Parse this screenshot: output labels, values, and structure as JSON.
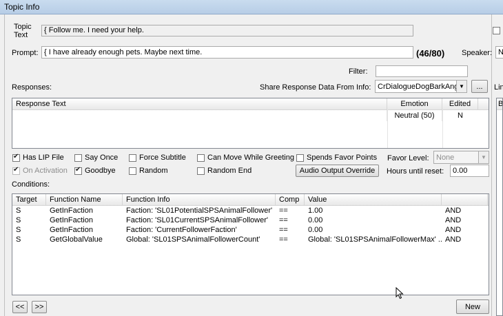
{
  "window": {
    "title": "Topic Info"
  },
  "topic": {
    "label_line1": "Topic",
    "label_line2": "Text",
    "value": "{ Follow me. I need your help."
  },
  "prompt": {
    "label": "Prompt:",
    "value": "{ I have already enough pets. Maybe next time.",
    "count": "(46/80)"
  },
  "speaker": {
    "label": "Speaker:",
    "value": "N"
  },
  "filter": {
    "label": "Filter:",
    "value": ""
  },
  "responses": {
    "label": "Responses:"
  },
  "share": {
    "label": "Share Response Data From Info:",
    "value": "CrDialogueDogBarkAng",
    "browse": "...",
    "link_label": "Lin"
  },
  "response_table": {
    "columns": [
      "Response Text",
      "Emotion",
      "Edited"
    ],
    "rows": [
      {
        "text": "",
        "emotion": "Neutral (50)",
        "edited": "N"
      }
    ],
    "side_header": "B"
  },
  "options": {
    "has_lip": {
      "label": "Has LIP File",
      "checked": true
    },
    "say_once": {
      "label": "Say Once",
      "checked": false
    },
    "force_subtitle": {
      "label": "Force Subtitle",
      "checked": false
    },
    "can_move": {
      "label": "Can Move While Greeting",
      "checked": false
    },
    "spends_favor": {
      "label": "Spends Favor Points",
      "checked": false
    },
    "on_activation": {
      "label": "On Activation",
      "checked": true
    },
    "goodbye": {
      "label": "Goodbye",
      "checked": true
    },
    "random": {
      "label": "Random",
      "checked": false
    },
    "random_end": {
      "label": "Random End",
      "checked": false
    },
    "audio_override": "Audio Output Override",
    "favor_level": {
      "label": "Favor Level:",
      "value": "None"
    },
    "hours_reset": {
      "label": "Hours until reset:",
      "value": "0.00"
    }
  },
  "conditions": {
    "label": "Conditions:",
    "columns": [
      "Target",
      "Function Name",
      "Function Info",
      "Comp",
      "Value",
      ""
    ],
    "rows": [
      {
        "target": "S",
        "func": "GetInFaction",
        "info": "Faction: 'SL01PotentialSPSAnimalFollower'",
        "comp": "==",
        "value": "1.00",
        "op": "AND"
      },
      {
        "target": "S",
        "func": "GetInFaction",
        "info": "Faction: 'SL01CurrentSPSAnimalFollower'",
        "comp": "==",
        "value": "0.00",
        "op": "AND"
      },
      {
        "target": "S",
        "func": "GetInFaction",
        "info": "Faction: 'CurrentFollowerFaction'",
        "comp": "==",
        "value": "0.00",
        "op": "AND"
      },
      {
        "target": "S",
        "func": "GetGlobalValue",
        "info": "Global: 'SL01SPSAnimalFollowerCount'",
        "comp": "==",
        "value": "Global: 'SL01SPSAnimalFollowerMax' ...",
        "op": "AND"
      }
    ]
  },
  "nav": {
    "prev": "<<",
    "next": ">>",
    "new": "New"
  }
}
